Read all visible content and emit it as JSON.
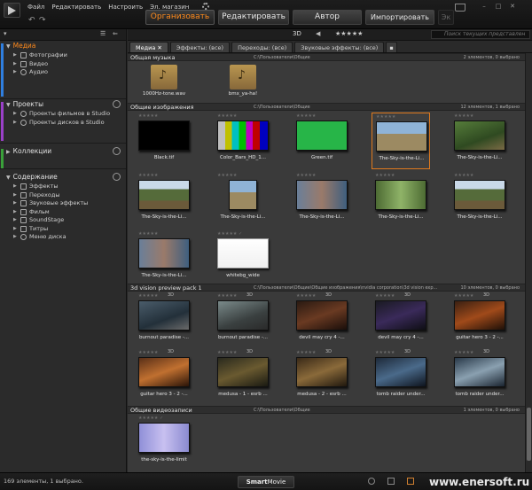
{
  "menu": {
    "file": "Файл",
    "edit": "Редактировать",
    "settings": "Настроить",
    "store": "Эл. магазин"
  },
  "modes": {
    "organize": "Организовать",
    "edit": "Редактировать",
    "author": "Автор",
    "import": "Импортировать",
    "export": "Эк"
  },
  "toolbar": {
    "threed": "3D",
    "stars": "★★★★★",
    "search_placeholder": "Поиск текущих представлен"
  },
  "tabs": [
    {
      "label": "Медиа"
    },
    {
      "label": "Эффекты: (все)"
    },
    {
      "label": "Переходы: (все)"
    },
    {
      "label": "Звуковые эффекты: (все)"
    }
  ],
  "sidebar": {
    "media": {
      "title": "Медиа",
      "items": [
        "Фотографии",
        "Видео",
        "Аудио"
      ]
    },
    "projects": {
      "title": "Проекты",
      "items": [
        "Проекты фильмов в Studio",
        "Проекты дисков в Studio"
      ]
    },
    "collections": {
      "title": "Коллекции"
    },
    "content": {
      "title": "Содержание",
      "items": [
        "Эффекты",
        "Переходы",
        "Звуковые эффекты",
        "Фильм",
        "SoundStage",
        "Титры",
        "Меню диска"
      ]
    }
  },
  "groups": [
    {
      "title": "Общая музыка",
      "path": "C:\\Пользователи\\Общие",
      "count": "2 элементов, 0 выбрано",
      "tiles": [
        {
          "label": "1000Hz-tone.wav"
        },
        {
          "label": "bmx_ya-ha!"
        }
      ]
    },
    {
      "title": "Общие изображения",
      "path": "C:\\Пользователи\\Общие",
      "count": "12 элементов, 1 выбрано",
      "tiles": [
        {
          "label": "Black.tif"
        },
        {
          "label": "Color_Bars_HD_1..."
        },
        {
          "label": "Green.tif"
        },
        {
          "label": "The-Sky-is-the-Li..."
        },
        {
          "label": "The-Sky-is-the-Li..."
        },
        {
          "label": "The-Sky-is-the-Li..."
        },
        {
          "label": "The-Sky-is-the-Li..."
        },
        {
          "label": "The-Sky-is-the-Li..."
        },
        {
          "label": "The-Sky-is-the-Li..."
        },
        {
          "label": "The-Sky-is-the-Li..."
        },
        {
          "label": "The-Sky-is-the-Li..."
        },
        {
          "label": "whitebg_wide"
        }
      ]
    },
    {
      "title": "3d vision preview pack 1",
      "path": "C:\\Пользователи\\Общие\\Общие изображения\\nvidia corporation\\3d vision exp...",
      "count": "10 элементов, 0 выбрано",
      "tiles": [
        {
          "label": "burnout paradise -..."
        },
        {
          "label": "burnout paradise -..."
        },
        {
          "label": "devil may cry 4 -..."
        },
        {
          "label": "devil may cry 4 -..."
        },
        {
          "label": "guitar hero 3 - 2 -..."
        },
        {
          "label": "guitar hero 3 - 2 -..."
        },
        {
          "label": "medusa - 1 - esrb ..."
        },
        {
          "label": "medusa - 2 - esrb ..."
        },
        {
          "label": "tomb raider under..."
        },
        {
          "label": "tomb raider under..."
        }
      ]
    },
    {
      "title": "Общие видеозаписи",
      "path": "C:\\Пользователи\\Общие",
      "count": "1 элементов, 0 выбрано",
      "tiles": [
        {
          "label": "the-sky-is-the-limit"
        }
      ]
    }
  ],
  "status": {
    "text": "169 элементы, 1 выбрано.",
    "smart_a": "Smart",
    "smart_b": "Movie"
  },
  "watermark": "www.enersoft.ru"
}
